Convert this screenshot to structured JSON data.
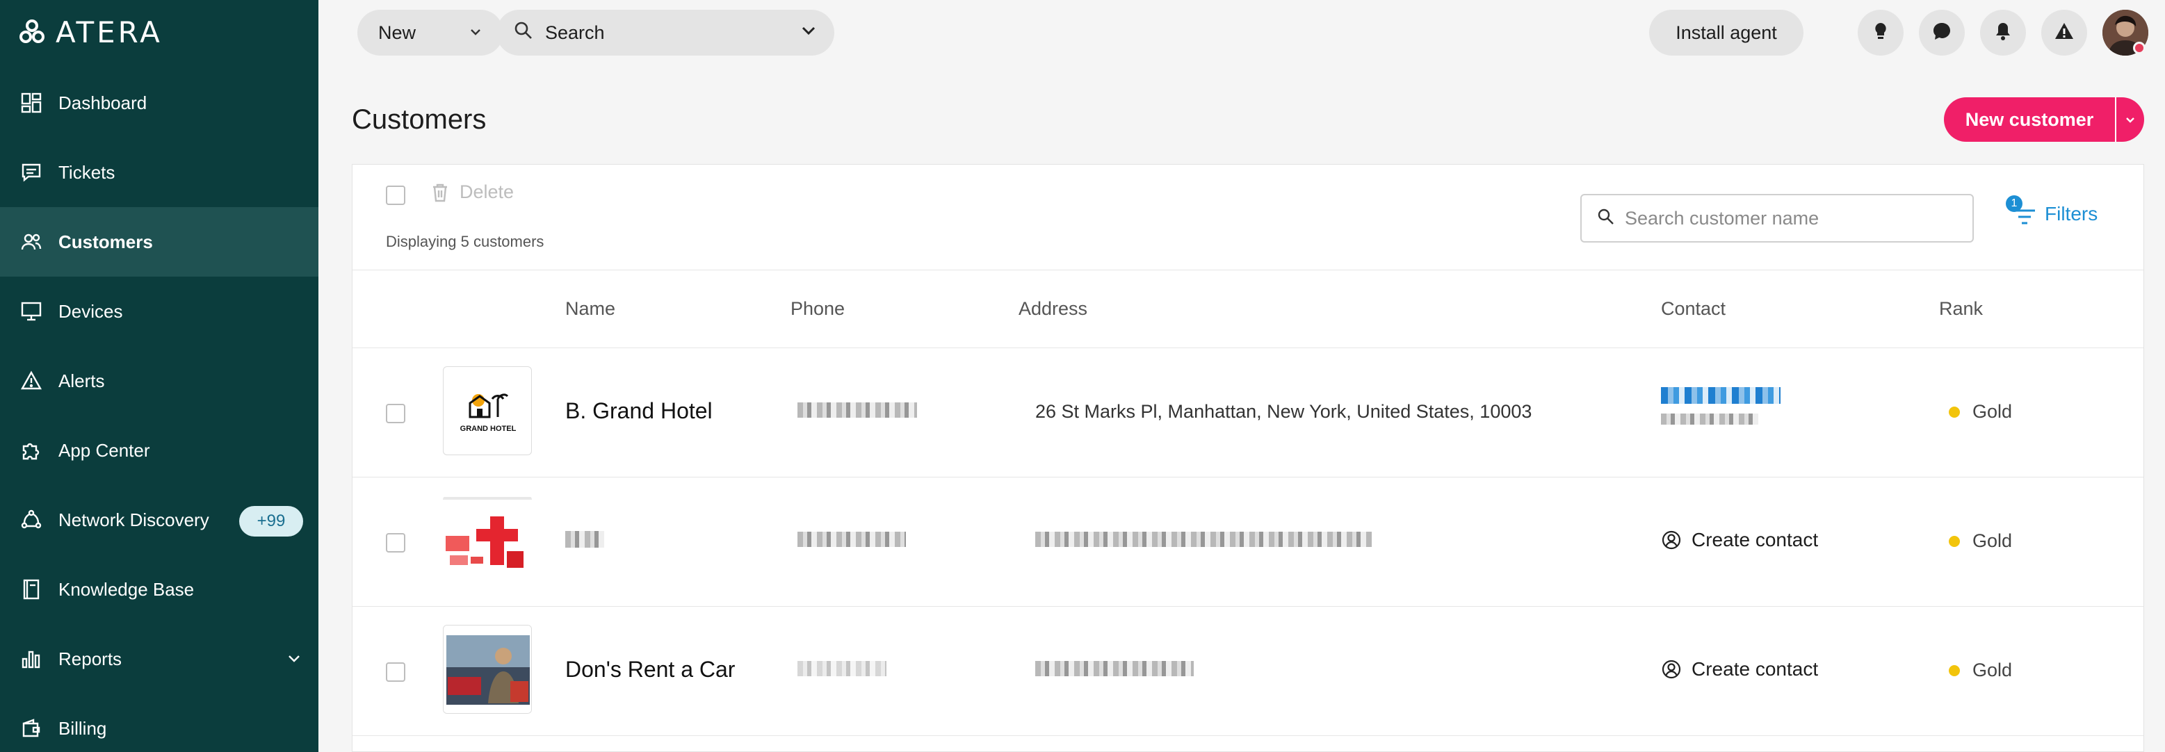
{
  "brand": {
    "logo_text": "ATERA"
  },
  "sidebar": {
    "items": [
      {
        "label": "Dashboard",
        "icon": "dashboard-icon"
      },
      {
        "label": "Tickets",
        "icon": "tickets-icon"
      },
      {
        "label": "Customers",
        "icon": "customers-icon",
        "active": true
      },
      {
        "label": "Devices",
        "icon": "devices-icon"
      },
      {
        "label": "Alerts",
        "icon": "alerts-icon"
      },
      {
        "label": "App Center",
        "icon": "puzzle-icon"
      },
      {
        "label": "Network Discovery",
        "icon": "network-icon",
        "badge": "+99"
      },
      {
        "label": "Knowledge Base",
        "icon": "book-icon"
      },
      {
        "label": "Reports",
        "icon": "bar-chart-icon"
      },
      {
        "label": "Billing",
        "icon": "wallet-icon"
      }
    ]
  },
  "topbar": {
    "new_label": "New",
    "search_label": "Search",
    "install_label": "Install agent"
  },
  "page": {
    "title": "Customers",
    "new_customer_label": "New customer"
  },
  "toolbar": {
    "delete_label": "Delete",
    "count_text": "Displaying 5 customers",
    "search_placeholder": "Search customer name",
    "filters_label": "Filters",
    "filters_count": "1"
  },
  "table": {
    "columns": [
      "Name",
      "Phone",
      "Address",
      "Contact",
      "Rank"
    ],
    "rows": [
      {
        "name": "B. Grand Hotel",
        "address": "26 St Marks Pl, Manhattan, New York, United States, 10003",
        "contact": "",
        "rank": "Gold",
        "thumb_text": "GRAND HOTEL"
      },
      {
        "name": "",
        "address": "",
        "contact": "Create contact",
        "rank": "Gold"
      },
      {
        "name": "Don's Rent a Car",
        "address": "",
        "contact": "Create contact",
        "rank": "Gold"
      }
    ]
  },
  "colors": {
    "sidebar_bg": "#0b3d3d",
    "accent_pink": "#f01f68",
    "link_blue": "#1d8fd4",
    "rank_gold": "#f2c40b"
  }
}
